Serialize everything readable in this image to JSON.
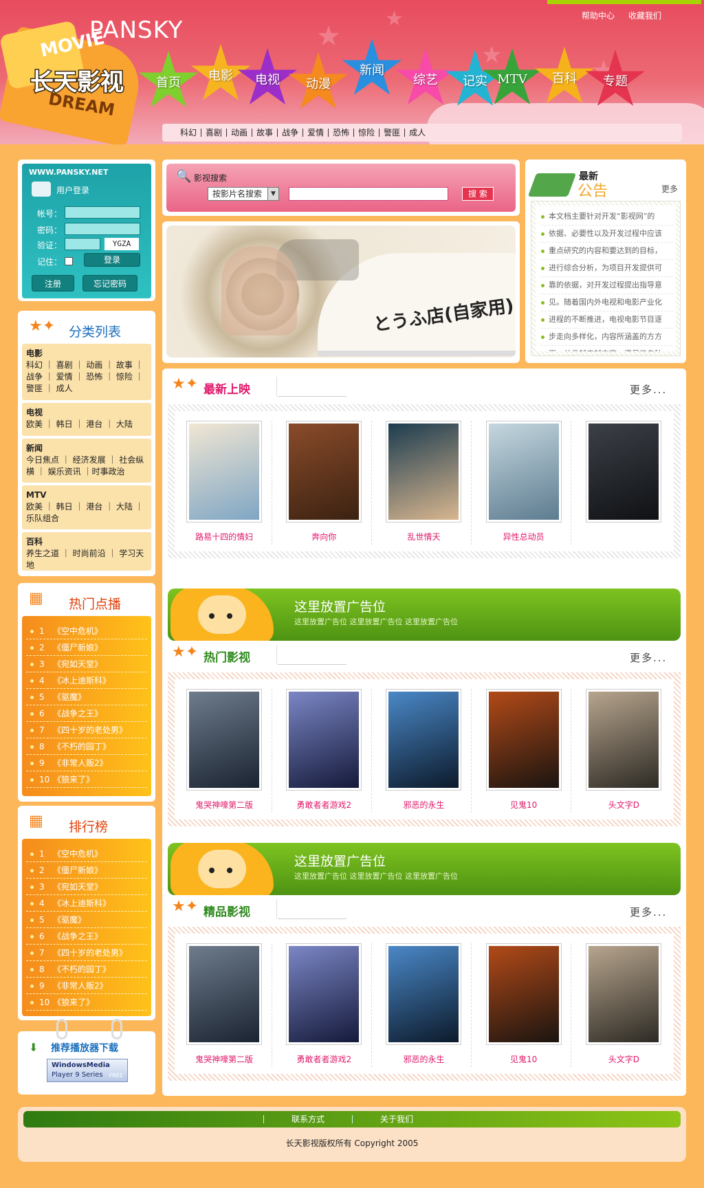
{
  "header": {
    "brand": "PANSKY",
    "logo": {
      "movie": "MOVIE",
      "name": "长天影视",
      "dream": "DREAM"
    },
    "top_links": [
      "帮助中心",
      "收藏我们"
    ],
    "nav": [
      {
        "label": "首页",
        "color": "#7fcf2e"
      },
      {
        "label": "电影",
        "color": "#f7b421"
      },
      {
        "label": "电视",
        "color": "#9b2ec8"
      },
      {
        "label": "动漫",
        "color": "#f58a1f"
      },
      {
        "label": "新闻",
        "color": "#2b8fe0"
      },
      {
        "label": "综艺",
        "color": "#f74aa9"
      },
      {
        "label": "记实",
        "color": "#24b4d3"
      },
      {
        "label": "MTV",
        "color": "#37a43a"
      },
      {
        "label": "百科",
        "color": "#f6b21a"
      },
      {
        "label": "专题",
        "color": "#e4344f"
      }
    ],
    "subnav": [
      "科幻",
      "喜剧",
      "动画",
      "故事",
      "战争",
      "爱情",
      "恐怖",
      "惊险",
      "警匪",
      "成人"
    ]
  },
  "login": {
    "url": "WWW.PANSKY.NET",
    "title": "用户登录",
    "account_label": "帐号：",
    "password_label": "密码：",
    "verify_label": "验证：",
    "captcha": "YGZA",
    "remember_label": "记住：",
    "login_button": "登录",
    "register_button": "注册",
    "forgot_button": "忘记密码"
  },
  "categories": {
    "title": "分类列表",
    "groups": [
      {
        "name": "电影",
        "items": "科幻 ｜ 喜剧 ｜ 动画 ｜ 故事 ｜ 战争 ｜ 爱情 ｜ 恐怖 ｜ 惊险 ｜ 警匪 ｜ 成人"
      },
      {
        "name": "电视",
        "items": "欧美 ｜ 韩日 ｜ 港台 ｜ 大陆"
      },
      {
        "name": "新闻",
        "items": "今日焦点 ｜ 经济发展 ｜ 社会纵横 ｜ 娱乐资讯 ｜时事政治"
      },
      {
        "name": "MTV",
        "items": "欧美 ｜ 韩日 ｜ 港台 ｜ 大陆 ｜ 乐队组合"
      },
      {
        "name": "百科",
        "items": "养生之道 ｜ 时尚前沿 ｜ 学习天地"
      }
    ]
  },
  "hot_play": {
    "title": "热门点播",
    "items": [
      "《空中危机》",
      "《僵尸新娘》",
      "《宛如天堂》",
      "《冰上迪斯科》",
      "《驱魔》",
      "《战争之王》",
      "《四十岁的老处男》",
      "《不朽的园丁》",
      "《非常人贩2》",
      "《狼来了》"
    ]
  },
  "ranking": {
    "title": "排行榜",
    "items": [
      "《空中危机》",
      "《僵尸新娘》",
      "《宛如天堂》",
      "《冰上迪斯科》",
      "《驱魔》",
      "《战争之王》",
      "《四十岁的老处男》",
      "《不朽的园丁》",
      "《非常人贩2》",
      "《狼来了》"
    ]
  },
  "download": {
    "title": "推荐播放器下载",
    "badge_line1": "WindowsMedia",
    "badge_line2": "Player 9 Series",
    "badge_free": "FREE"
  },
  "search": {
    "label": "影视搜索",
    "select_value": "按影片名搜索",
    "button": "搜 索"
  },
  "banner": {
    "text": "とうふ店(自家用)"
  },
  "notice": {
    "title_small": "最新",
    "title_big": "公告",
    "more": "更多",
    "lines": [
      "本文档主要针对开发“影视网”的",
      "依据、必要性以及开发过程中应该",
      "重点研究的内容和要达到的目标，",
      "进行综合分析，为项目开发提供可",
      "靠的依据，对开发过程提出指导意",
      "见。随着国内外电视和电影产业化",
      "进程的不断推进，电视电影节目逐",
      "步走向多样化，内容所涵盖的方方",
      "面，并且越来越丰富，满足了各种"
    ]
  },
  "sections": [
    {
      "title": "最新上映",
      "title_color": "#e0186b",
      "more": "更多...",
      "items": [
        {
          "caption": "路易十四的情妇",
          "poster_colors": [
            "#7fa6c4",
            "#f1e6d3"
          ]
        },
        {
          "caption": "奔向你",
          "poster_colors": [
            "#3b2211",
            "#8a4b2a"
          ]
        },
        {
          "caption": "乱世情天",
          "poster_colors": [
            "#d8b68f",
            "#1c3c4f"
          ]
        },
        {
          "caption": "异性总动员",
          "poster_colors": [
            "#5d7c90",
            "#c5d7df"
          ]
        },
        {
          "caption": "",
          "poster_colors": [
            "#0f1114",
            "#3c4047"
          ]
        }
      ]
    },
    {
      "title": "热门影视",
      "title_color": "#2e8a1d",
      "more": "更多...",
      "items": [
        {
          "caption": "鬼哭神嚎第二版",
          "poster_colors": [
            "#1a2331",
            "#6e7c8c"
          ]
        },
        {
          "caption": "勇敢者者游戏2",
          "poster_colors": [
            "#151a3a",
            "#7b86c5"
          ]
        },
        {
          "caption": "邪恶的永生",
          "poster_colors": [
            "#0c1a2b",
            "#4a88c7"
          ]
        },
        {
          "caption": "见鬼10",
          "poster_colors": [
            "#1a1410",
            "#b24a18"
          ]
        },
        {
          "caption": "头文字D",
          "poster_colors": [
            "#2d2a24",
            "#b7a58e"
          ]
        }
      ]
    },
    {
      "title": "精品影视",
      "title_color": "#2e8a1d",
      "more": "更多...",
      "items": [
        {
          "caption": "鬼哭神嚎第二版",
          "poster_colors": [
            "#1a2331",
            "#6e7c8c"
          ]
        },
        {
          "caption": "勇敢者者游戏2",
          "poster_colors": [
            "#151a3a",
            "#7b86c5"
          ]
        },
        {
          "caption": "邪恶的永生",
          "poster_colors": [
            "#0c1a2b",
            "#4a88c7"
          ]
        },
        {
          "caption": "见鬼10",
          "poster_colors": [
            "#1a1410",
            "#b24a18"
          ]
        },
        {
          "caption": "头文字D",
          "poster_colors": [
            "#2d2a24",
            "#b7a58e"
          ]
        }
      ]
    }
  ],
  "ads": [
    {
      "title": "这里放置广告位",
      "sub": "这里放置广告位 这里放置广告位 这里放置广告位"
    },
    {
      "title": "这里放置广告位",
      "sub": "这里放置广告位 这里放置广告位 这里放置广告位"
    }
  ],
  "footer": {
    "links": [
      "联系方式",
      "关于我们"
    ],
    "copyright": "长天影视版权所有 Copyright 2005"
  }
}
